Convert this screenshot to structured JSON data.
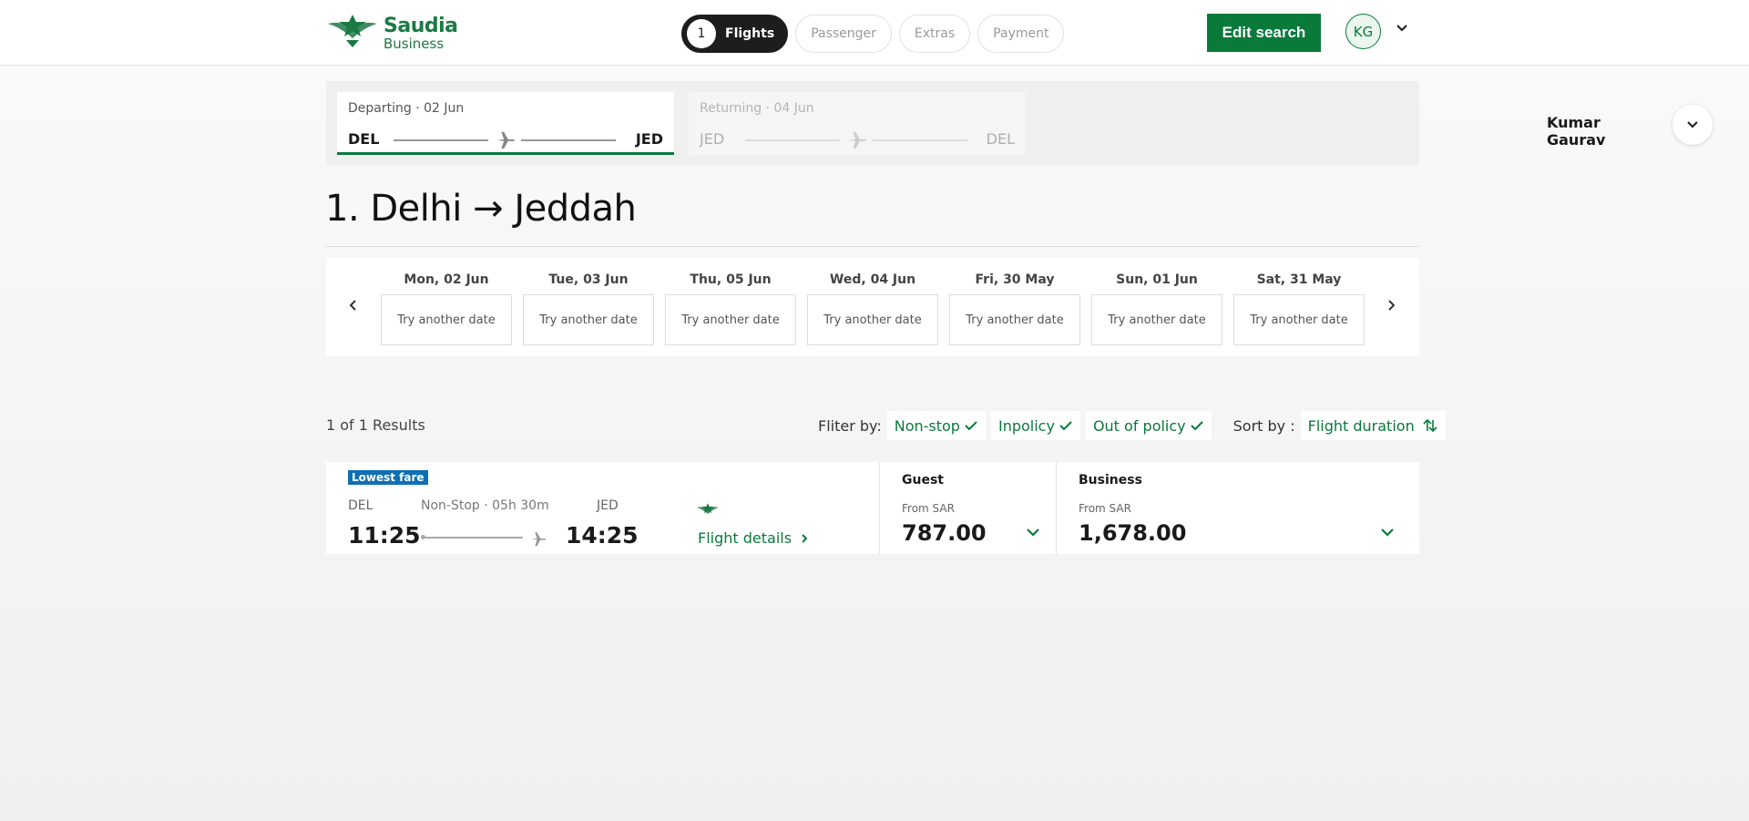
{
  "brand": {
    "name": "Saudia",
    "sub": "Business",
    "color": "#0a7a3a"
  },
  "steps": [
    {
      "num": "1",
      "label": "Flights",
      "active": true
    },
    {
      "label": "Passenger"
    },
    {
      "label": "Extras"
    },
    {
      "label": "Payment"
    }
  ],
  "header": {
    "edit_search": "Edit search",
    "avatar_initials": "KG"
  },
  "trip": {
    "departing": {
      "label": "Departing · 02 Jun",
      "from": "DEL",
      "to": "JED"
    },
    "returning": {
      "label": "Returning · 04 Jun",
      "from": "JED",
      "to": "DEL"
    },
    "traveler": "Kumar Gaurav"
  },
  "route_title": "1. Delhi → Jeddah",
  "dates": [
    {
      "day": "Mon, 02 Jun",
      "status": "Try another date"
    },
    {
      "day": "Tue, 03 Jun",
      "status": "Try another date"
    },
    {
      "day": "Thu, 05 Jun",
      "status": "Try another date"
    },
    {
      "day": "Wed, 04 Jun",
      "status": "Try another date"
    },
    {
      "day": "Fri, 30 May",
      "status": "Try another date"
    },
    {
      "day": "Sun, 01 Jun",
      "status": "Try another date"
    },
    {
      "day": "Sat, 31 May",
      "status": "Try another date"
    }
  ],
  "results": {
    "count": "1 of 1 Results",
    "filter_label": "Fliter by:",
    "filters": [
      "Non-stop",
      "Inpolicy",
      "Out of policy"
    ],
    "sort_label": "Sort by :",
    "sort_value": "Flight duration"
  },
  "flight": {
    "badge": "Lowest fare",
    "from": "DEL",
    "to": "JED",
    "duration": "Non-Stop · 05h 30m",
    "dep_time": "11:25",
    "arr_time": "14:25",
    "details": "Flight details",
    "fares": [
      {
        "name": "Guest",
        "from": "From SAR",
        "price": "787.00"
      },
      {
        "name": "Business",
        "from": "From SAR",
        "price": "1,678.00"
      }
    ]
  }
}
